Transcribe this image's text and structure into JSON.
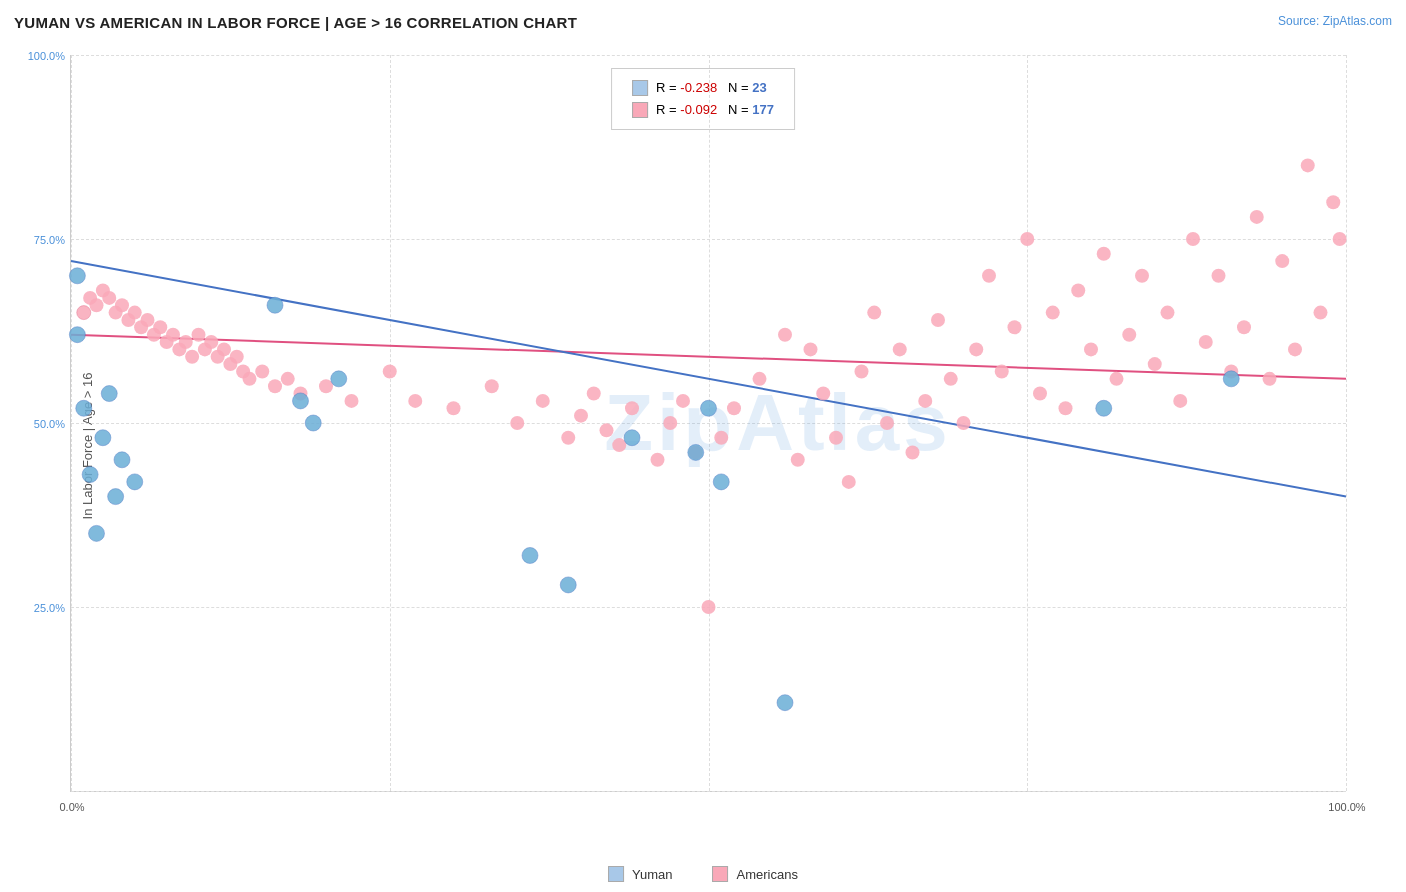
{
  "title": "YUMAN VS AMERICAN IN LABOR FORCE | AGE > 16 CORRELATION CHART",
  "source": "Source: ZipAtlas.com",
  "yAxisLabel": "In Labor Force | Age > 16",
  "legend": {
    "yuman_label": "Yuman",
    "americans_label": "Americans"
  },
  "legend_box": {
    "row1": {
      "r": "R = -0.238",
      "n": "N = 23",
      "color": "blue"
    },
    "row2": {
      "r": "R = -0.092",
      "n": "N = 177",
      "color": "pink"
    }
  },
  "yTicks": [
    "100.0%",
    "75.0%",
    "50.0%",
    "25.0%"
  ],
  "xTicks": [
    "0.0%",
    "100.0%"
  ],
  "colors": {
    "yuman": "#6baed6",
    "americans": "#f4a0b0",
    "trendYuman": "#4472c4",
    "trendAmericans": "#e05080",
    "accent": "#4a90d9"
  }
}
